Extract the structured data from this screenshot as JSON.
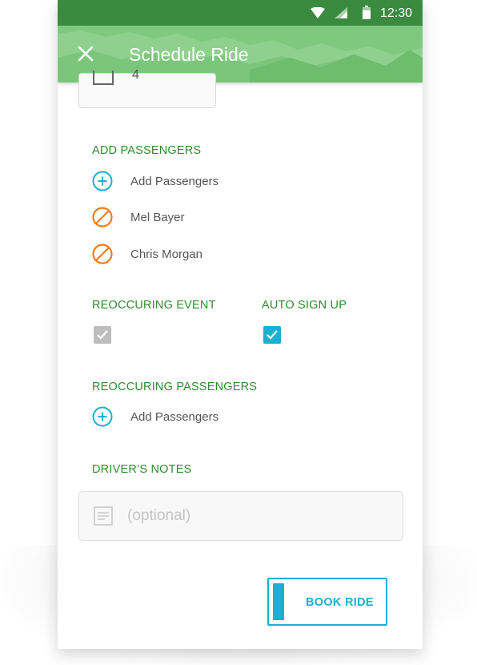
{
  "status_bar": {
    "time": "12:30",
    "icons": [
      "wifi-icon",
      "signal-icon",
      "battery-icon"
    ]
  },
  "app_bar": {
    "title": "Schedule Ride",
    "close_icon": "close-icon"
  },
  "seats": {
    "value": "4"
  },
  "add_passengers": {
    "label": "ADD PASSENGERS",
    "add_label": "Add Passengers",
    "passengers": [
      {
        "name": "Mel Bayer",
        "icon": "remove-icon"
      },
      {
        "name": "Chris Morgan",
        "icon": "remove-icon"
      }
    ]
  },
  "reoccuring_event": {
    "label": "REOCCURING EVENT",
    "checked": true,
    "enabled": false
  },
  "auto_sign_up": {
    "label": "AUTO SIGN UP",
    "checked": true,
    "enabled": true
  },
  "reoccuring_passengers": {
    "label": "REOCCURING PASSENGERS",
    "add_label": "Add Passengers"
  },
  "drivers_notes": {
    "label": "DRIVER’S NOTES",
    "placeholder": "(optional)"
  },
  "book_button": {
    "label": "BOOK RIDE"
  },
  "colors": {
    "status_bar": "#3a8b3f",
    "app_bar": "#7ec97e",
    "section_label": "#2e8b2e",
    "accent": "#1ab0cf",
    "remove": "#f07c1d",
    "disabled": "#bdbdbd"
  }
}
